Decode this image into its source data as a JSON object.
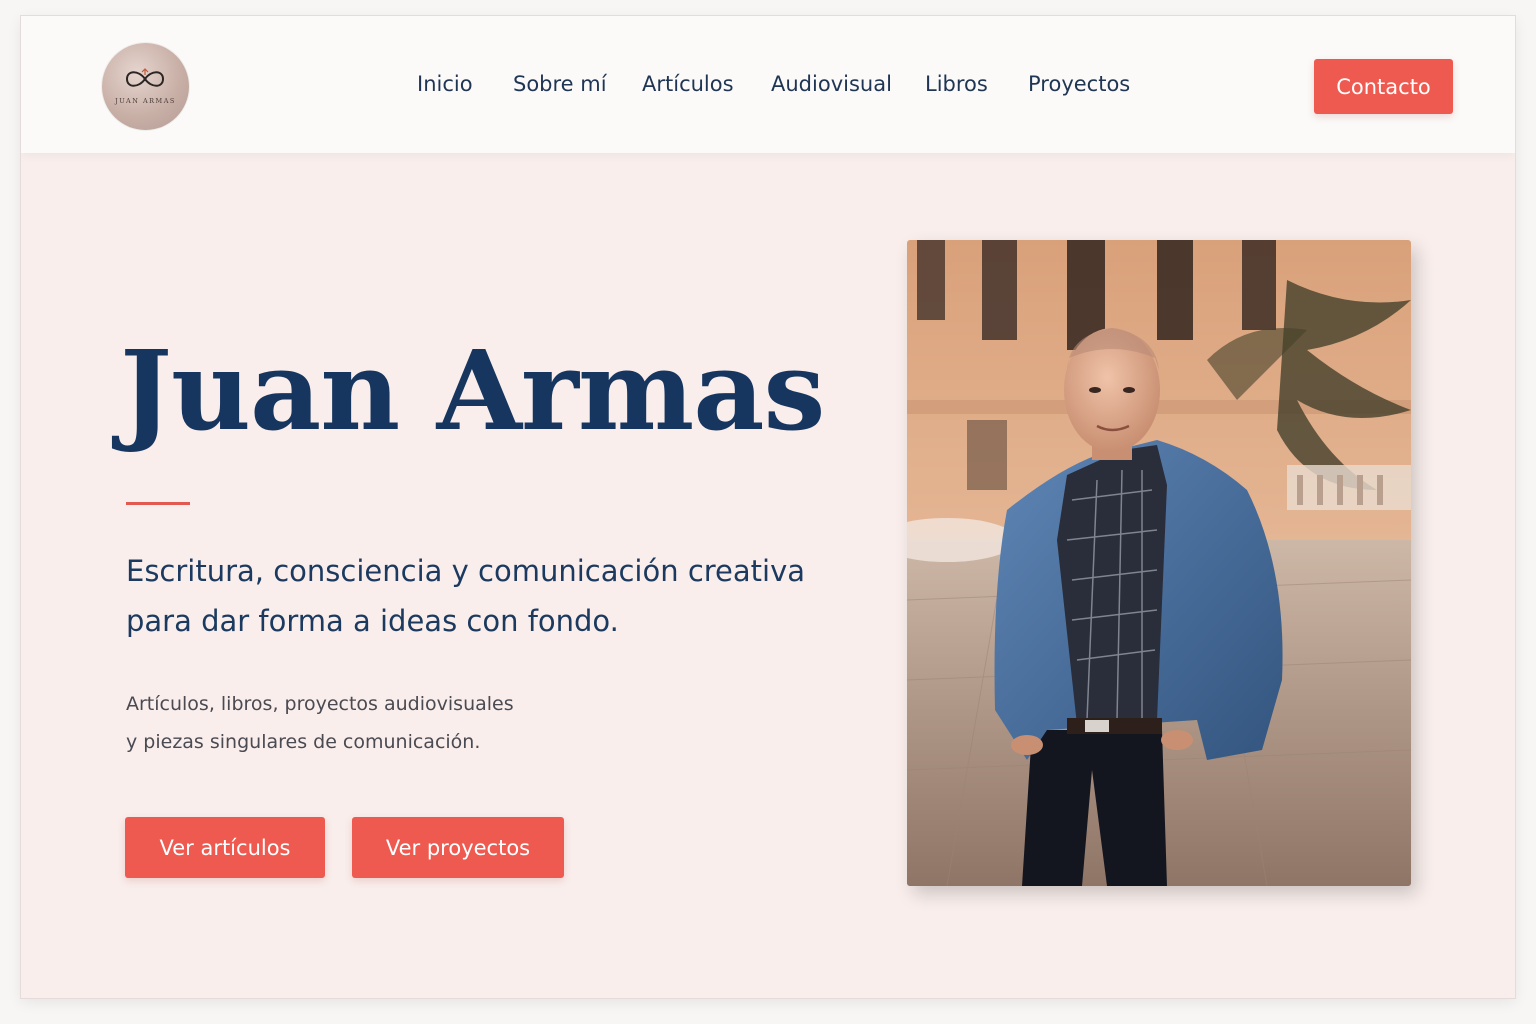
{
  "brand": {
    "logo_text": "JUAN ARMAS"
  },
  "nav": {
    "items": [
      {
        "label": "Inicio"
      },
      {
        "label": "Sobre mí"
      },
      {
        "label": "Artículos"
      },
      {
        "label": "Audiovisual"
      },
      {
        "label": "Libros"
      },
      {
        "label": "Proyectos"
      }
    ],
    "contact_label": "Contacto"
  },
  "hero": {
    "title": "Juan Armas",
    "subtitle_lines": [
      "Escritura, consciencia y comunicación creativa",
      "para dar forma a ideas con fondo."
    ],
    "description_lines": [
      "Artículos, libros, proyectos audiovisuales",
      "y piezas singulares de comunicación."
    ],
    "primary_button": "Ver artículos",
    "secondary_button": "Ver proyectos"
  },
  "colors": {
    "accent": "#ef5a50",
    "navy": "#17365f",
    "background": "#f9eeec"
  }
}
